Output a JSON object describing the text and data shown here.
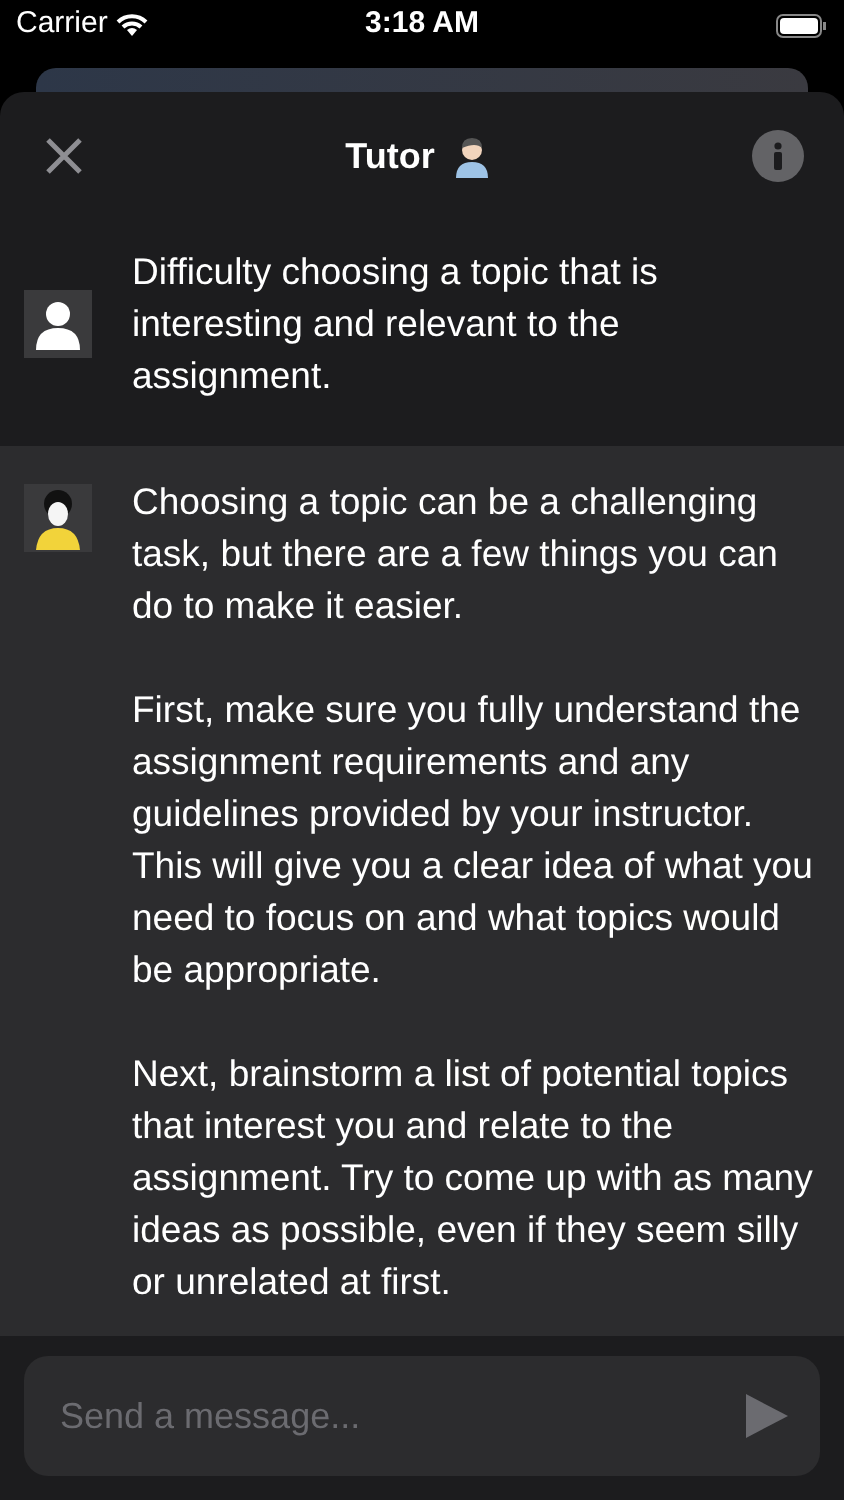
{
  "status_bar": {
    "carrier": "Carrier",
    "time": "3:18 AM"
  },
  "header": {
    "title": "Tutor"
  },
  "messages": [
    {
      "kind": "user",
      "paragraphs": [
        "Difficulty choosing a topic that is interesting and relevant to the assignment."
      ]
    },
    {
      "kind": "assistant",
      "paragraphs": [
        "Choosing a topic can be a challenging task, but there are a few things you can do to make it easier.",
        "First, make sure you fully understand the assignment requirements and any guidelines provided by your instructor. This will give you a clear idea of what you need to focus on and what topics would be appropriate.",
        "Next, brainstorm a list of potential topics that interest you and relate to the assignment. Try to come up with as many ideas as possible, even if they seem silly or unrelated at first."
      ]
    }
  ],
  "composer": {
    "placeholder": "Send a message..."
  }
}
